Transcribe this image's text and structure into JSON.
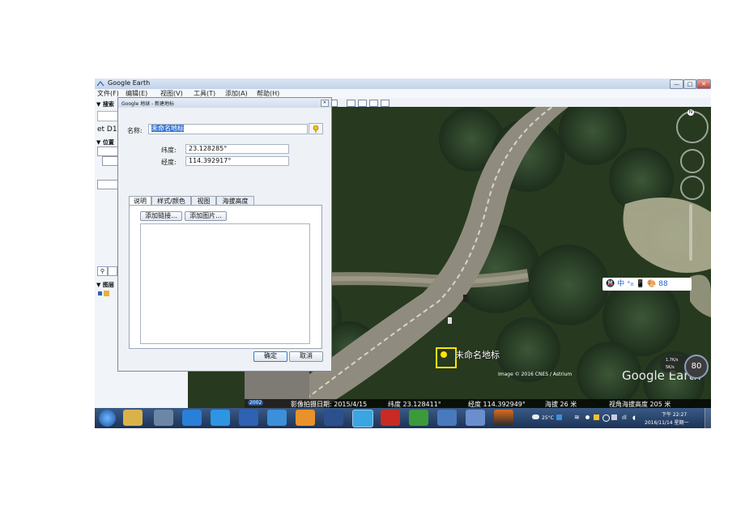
{
  "window": {
    "title": "Google Earth",
    "controls": {
      "minimize": "—",
      "maximize": "□",
      "close": "✕"
    }
  },
  "menu": [
    "文件(F)",
    "编辑(E)",
    "视图(V)",
    "工具(T)",
    "添加(A)",
    "帮助(H)"
  ],
  "left_panel": {
    "search_header": "▼ 搜索",
    "fragment_text": "et D1",
    "places_header": "▼ 位置",
    "layers_header": "▼ 图层"
  },
  "dialog": {
    "title": "Google 地球 - 新建地标",
    "name_label": "名称:",
    "name_value": "未命名地标",
    "latitude_label": "纬度:",
    "latitude_value": "23.128285°",
    "longitude_label": "经度:",
    "longitude_value": "114.392917°",
    "tabs": [
      "说明",
      "样式/颜色",
      "视图",
      "海拔高度"
    ],
    "add_link_button": "添加链接...",
    "add_image_button": "添加图片...",
    "ok_button": "确定",
    "cancel_button": "取消"
  },
  "map": {
    "placemark_label": "未命名地标",
    "attribution": "Image © 2016 CNES / Astrium",
    "logo": "Google Earth",
    "zoom_percent": "80",
    "speed_top": "1.7K/s",
    "speed_bottom": "5K/s",
    "status": {
      "year": "2002",
      "imagery_date": "影像拍摄日期: 2015/4/15",
      "latitude": "纬度  23.128411°",
      "longitude": "经度  114.392949°",
      "elevation": "海拔   26 米",
      "eye_alt": "视角海拔高度   205 米"
    },
    "street_icons": "🚇 中 ⁺₀ 📱 🎨 88"
  },
  "taskbar": {
    "weather": "25°C",
    "clock_time": "下午 22:27",
    "clock_date": "2016/11/14 星期一"
  },
  "colors": {
    "placemark_box": "#ffe600",
    "title_blue": "#c3d3e9",
    "taskbar": "#1c3357"
  }
}
